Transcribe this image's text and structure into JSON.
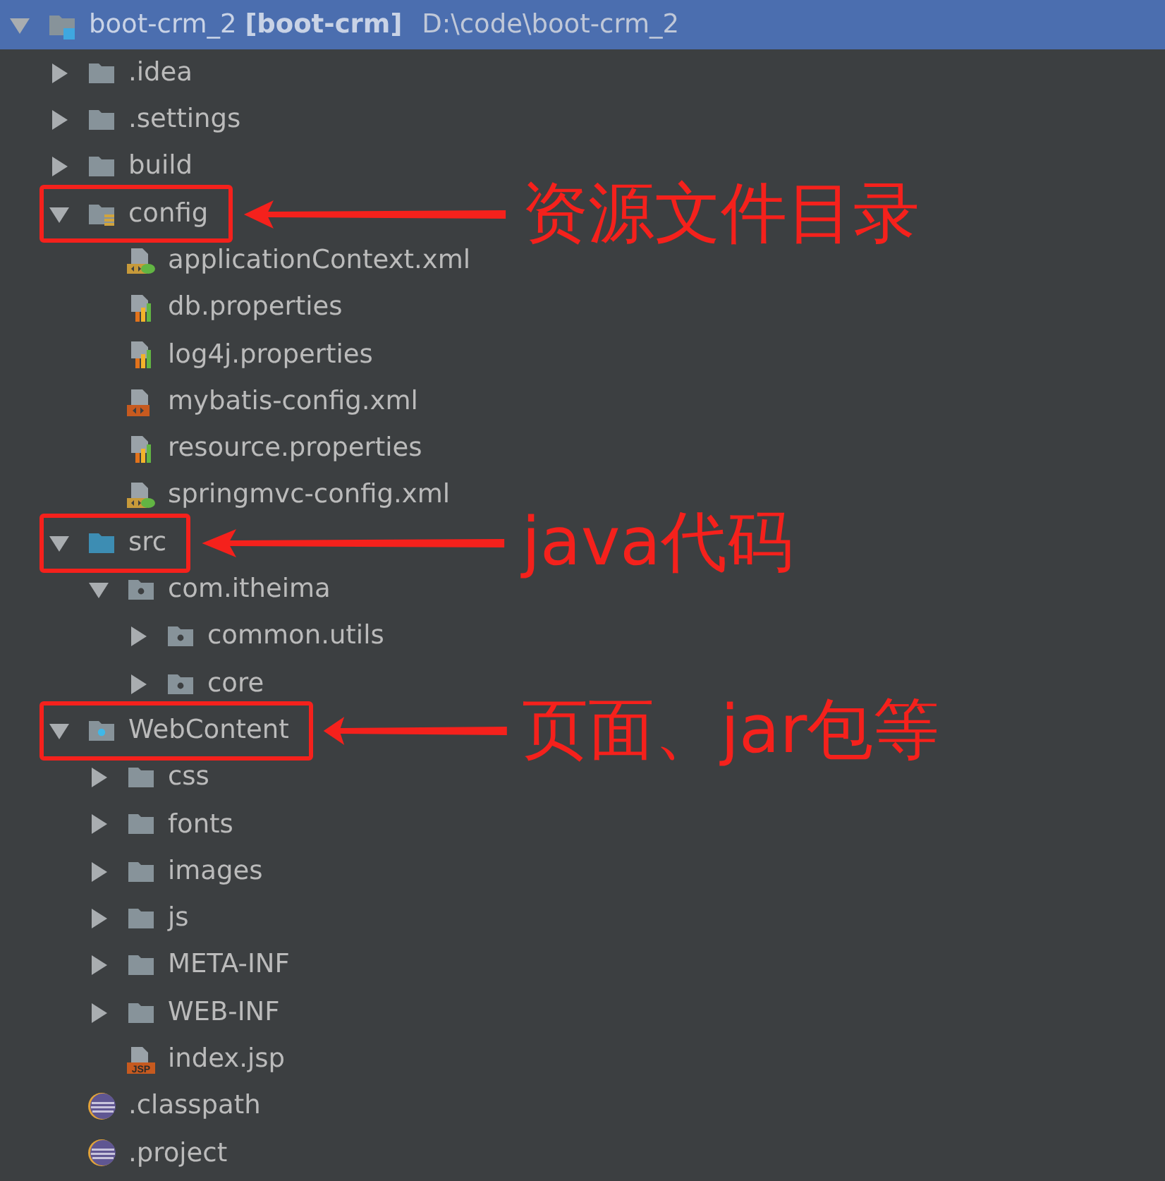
{
  "tree": [
    {
      "name": "boot-crm_2 **[boot-crm]**",
      "path": "D:\\code\\boot-crm_2",
      "kind": "module",
      "selected": true,
      "expanded": true,
      "children": [
        {
          "name": ".idea",
          "kind": "folder",
          "selected": false,
          "expanded": false
        },
        {
          "name": ".settings",
          "kind": "folder",
          "selected": false,
          "expanded": false
        },
        {
          "name": "build",
          "kind": "folder",
          "selected": false,
          "expanded": false
        },
        {
          "name": "config",
          "kind": "resource-folder",
          "selected": false,
          "expanded": true,
          "callout": "资源文件目录",
          "children": [
            {
              "name": "applicationContext.xml",
              "kind": "spring-xml",
              "selected": false
            },
            {
              "name": "db.properties",
              "kind": "properties",
              "selected": false
            },
            {
              "name": "log4j.properties",
              "kind": "properties",
              "selected": false
            },
            {
              "name": "mybatis-config.xml",
              "kind": "xml",
              "selected": false
            },
            {
              "name": "resource.properties",
              "kind": "properties",
              "selected": false
            },
            {
              "name": "springmvc-config.xml",
              "kind": "spring-xml",
              "selected": false
            }
          ]
        },
        {
          "name": "src",
          "kind": "source-folder",
          "selected": false,
          "expanded": true,
          "callout": "java代码",
          "children": [
            {
              "name": "com.itheima",
              "kind": "package",
              "selected": false,
              "expanded": true,
              "children": [
                {
                  "name": "common.utils",
                  "kind": "package",
                  "selected": false,
                  "expanded": false
                },
                {
                  "name": "core",
                  "kind": "package",
                  "selected": false,
                  "expanded": false
                }
              ]
            }
          ]
        },
        {
          "name": "WebContent",
          "kind": "web-folder",
          "selected": false,
          "expanded": true,
          "callout": "页面、jar包等",
          "children": [
            {
              "name": "css",
              "kind": "folder",
              "selected": false,
              "expanded": false
            },
            {
              "name": "fonts",
              "kind": "folder",
              "selected": false,
              "expanded": false
            },
            {
              "name": "images",
              "kind": "folder",
              "selected": false,
              "expanded": false
            },
            {
              "name": "js",
              "kind": "folder",
              "selected": false,
              "expanded": false
            },
            {
              "name": "META-INF",
              "kind": "folder",
              "selected": false,
              "expanded": false
            },
            {
              "name": "WEB-INF",
              "kind": "folder",
              "selected": false,
              "expanded": false
            },
            {
              "name": "index.jsp",
              "kind": "jsp",
              "icon_text": "JSP",
              "selected": false
            }
          ]
        },
        {
          "name": ".classpath",
          "kind": "eclipse",
          "selected": false
        },
        {
          "name": ".project",
          "kind": "eclipse",
          "selected": false
        }
      ]
    }
  ]
}
